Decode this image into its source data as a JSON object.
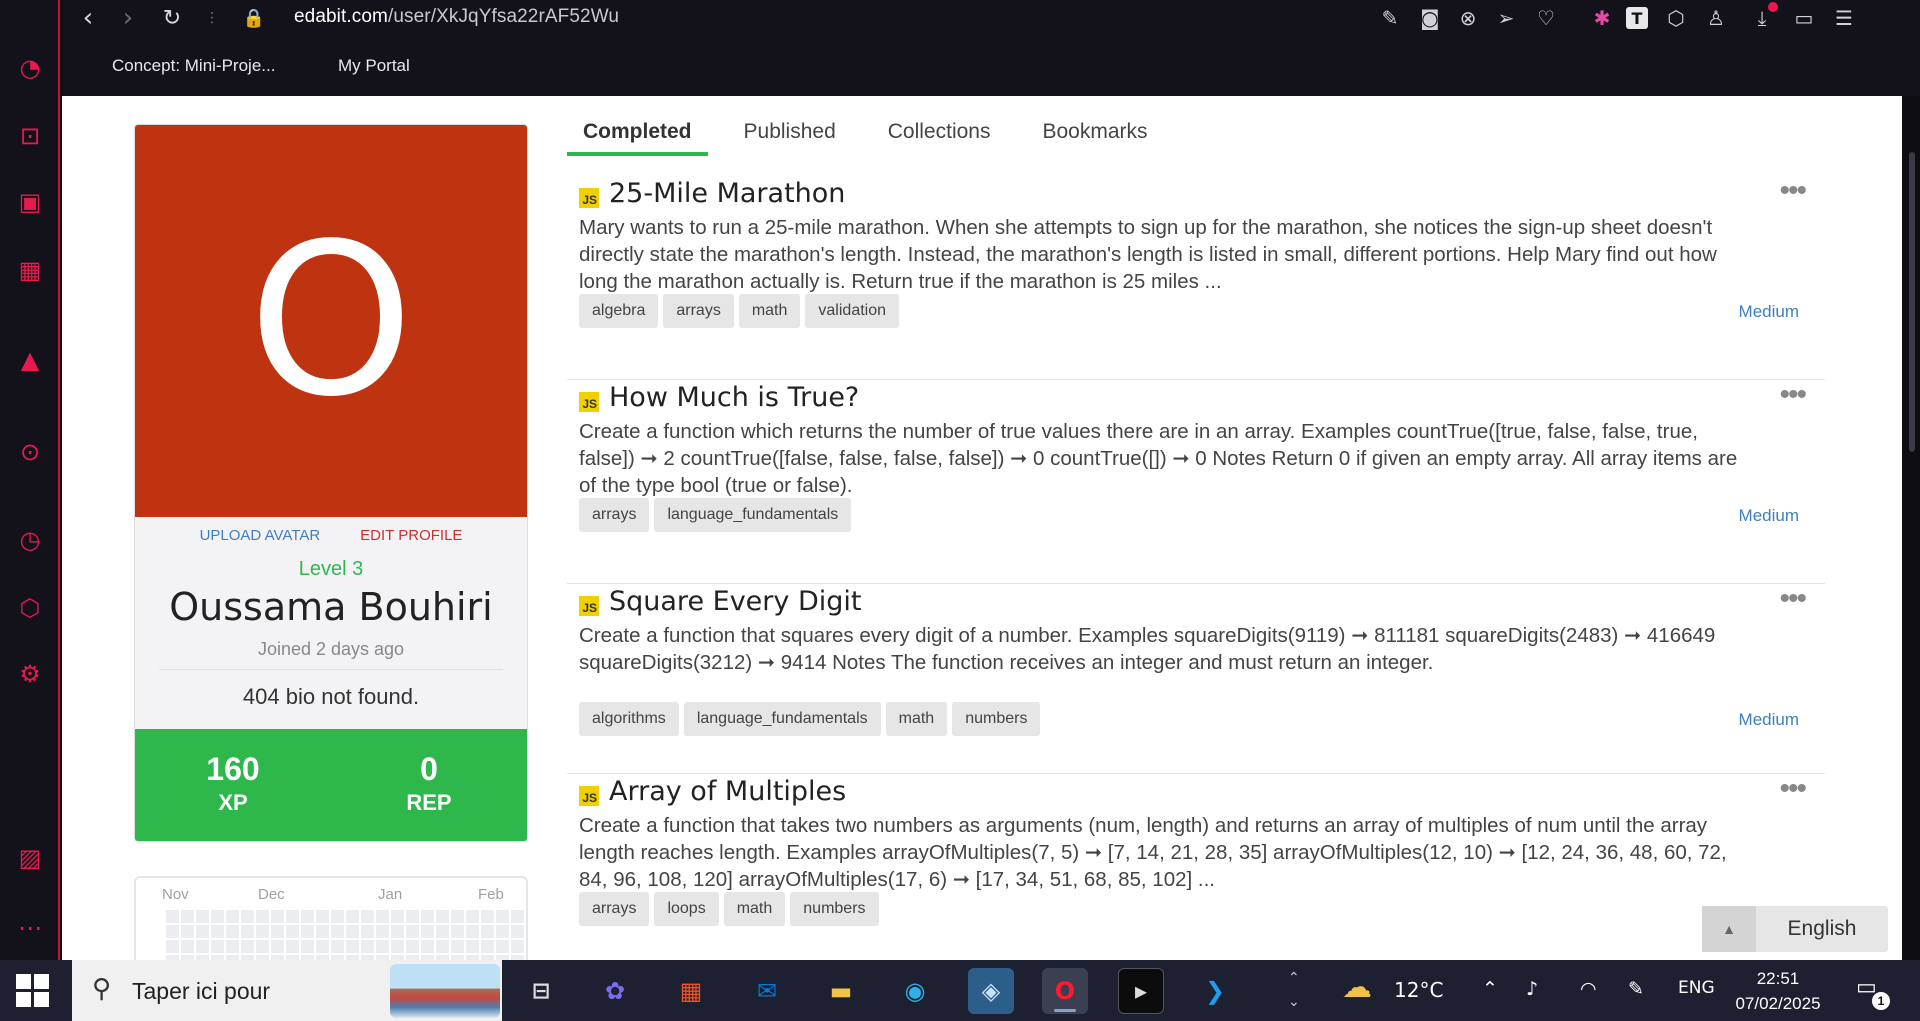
{
  "browser": {
    "url_host": "edabit.com",
    "url_path": "/user/XkJqYfsa22rAF52Wu",
    "bookmarks": [
      "Concept: Mini-Proje...",
      "My Portal"
    ]
  },
  "profile": {
    "avatar_letter": "O",
    "upload_avatar": "UPLOAD AVATAR",
    "edit_profile": "EDIT PROFILE",
    "level": "Level 3",
    "name": "Oussama Bouhiri",
    "joined": "Joined 2 days ago",
    "bio": "404 bio not found.",
    "stats": [
      {
        "value": "160",
        "label": "XP"
      },
      {
        "value": "0",
        "label": "REP"
      }
    ],
    "calendar_months": [
      "Nov",
      "Dec",
      "Jan",
      "Feb"
    ]
  },
  "tabs": [
    "Completed",
    "Published",
    "Collections",
    "Bookmarks"
  ],
  "active_tab": "Completed",
  "challenges": [
    {
      "lang": "JS",
      "title": "25-Mile Marathon",
      "description": "Mary wants to run a 25-mile marathon. When she attempts to sign up for the marathon, she notices the sign-up sheet doesn't directly state the marathon's length. Instead, the marathon's length is listed in small, different portions. Help Mary find out how long the marathon actually is. Return true if the marathon is 25 miles ...",
      "tags": [
        "algebra",
        "arrays",
        "math",
        "validation"
      ],
      "difficulty": "Medium"
    },
    {
      "lang": "JS",
      "title": "How Much is True?",
      "description": "Create a function which returns the number of true values there are in an array. Examples countTrue([true, false, false, true, false]) ➞ 2 countTrue([false, false, false, false]) ➞ 0 countTrue([]) ➞ 0 Notes Return 0 if given an empty array. All array items are of the type bool (true or false).",
      "tags": [
        "arrays",
        "language_fundamentals"
      ],
      "difficulty": "Medium"
    },
    {
      "lang": "JS",
      "title": "Square Every Digit",
      "description": "Create a function that squares every digit of a number. Examples squareDigits(9119) ➞ 811181 squareDigits(2483) ➞ 416649 squareDigits(3212) ➞ 9414 Notes The function receives an integer and must return an integer.",
      "tags": [
        "algorithms",
        "language_fundamentals",
        "math",
        "numbers"
      ],
      "difficulty": "Medium"
    },
    {
      "lang": "JS",
      "title": "Array of Multiples",
      "description": "Create a function that takes two numbers as arguments (num, length) and returns an array of multiples of num until the array length reaches length. Examples arrayOfMultiples(7, 5) ➞ [7, 14, 21, 28, 35] arrayOfMultiples(12, 10) ➞ [12, 24, 36, 48, 60, 72, 84, 96, 108, 120] arrayOfMultiples(17, 6) ➞ [17, 34, 51, 68, 85, 102] ...",
      "tags": [
        "arrays",
        "loops",
        "math",
        "numbers"
      ],
      "difficulty": ""
    }
  ],
  "language_button": "English",
  "taskbar": {
    "search_text": "Taper ici pour",
    "weather": "12°C",
    "lang": "ENG",
    "time": "22:51",
    "date": "07/02/2025",
    "notifications": "1"
  },
  "colors": {
    "accent_green": "#2eb84c",
    "avatar_bg": "#be3411",
    "link_blue": "#3f7fbf",
    "sidebar_accent": "#e8194c"
  }
}
